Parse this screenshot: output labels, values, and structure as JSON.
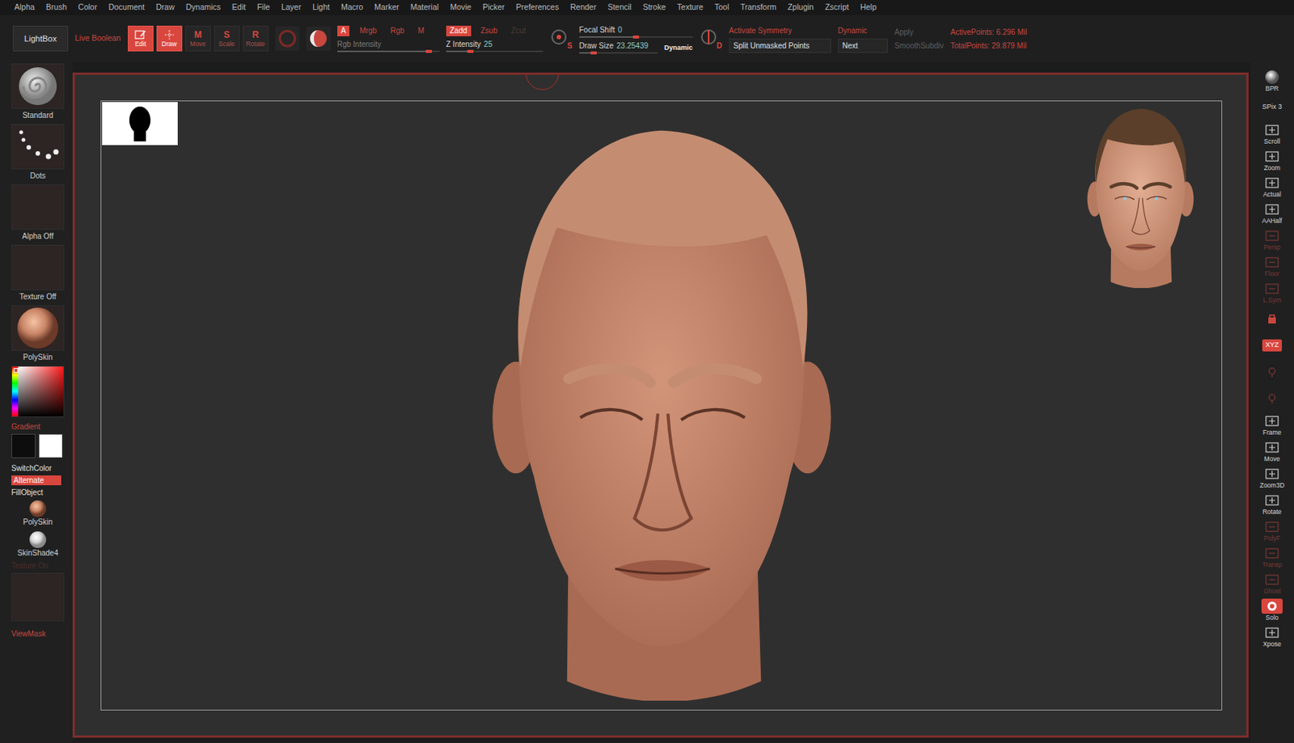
{
  "menu": [
    "Alpha",
    "Brush",
    "Color",
    "Document",
    "Draw",
    "Dynamics",
    "Edit",
    "File",
    "Layer",
    "Light",
    "Macro",
    "Marker",
    "Material",
    "Movie",
    "Picker",
    "Preferences",
    "Render",
    "Stencil",
    "Stroke",
    "Texture",
    "Tool",
    "Transform",
    "Zplugin",
    "Zscript",
    "Help"
  ],
  "toolbar": {
    "lightbox": "LightBox",
    "live_boolean": "Live Boolean",
    "modes": [
      {
        "label": "Edit",
        "kind": "icon",
        "selected": true
      },
      {
        "label": "Draw",
        "kind": "icon",
        "selected": true
      },
      {
        "label": "Move",
        "key": "M",
        "kind": "letter",
        "selected": false
      },
      {
        "label": "Scale",
        "key": "S",
        "kind": "letter",
        "selected": false
      },
      {
        "label": "Rotate",
        "key": "R",
        "kind": "letter",
        "selected": false
      }
    ],
    "color_channels": [
      {
        "label": "A",
        "selected": true
      },
      {
        "label": "Mrgb",
        "selected": false
      },
      {
        "label": "Rgb",
        "selected": false
      },
      {
        "label": "M",
        "selected": false
      }
    ],
    "rgb_intensity": {
      "label": "Rgb Intensity",
      "level": 0.9,
      "disabled": true
    },
    "depth_channels": [
      {
        "label": "Zadd",
        "selected": true,
        "disabled": false
      },
      {
        "label": "Zsub",
        "selected": false,
        "disabled": false
      },
      {
        "label": "Zcut",
        "selected": false,
        "disabled": true
      }
    ],
    "z_intensity": {
      "label": "Z Intensity",
      "value": "25",
      "level": 0.25
    },
    "stroke_key": "S",
    "focal_shift": {
      "label": "Focal Shift",
      "value": "0",
      "level": 0.5
    },
    "draw_size": {
      "label": "Draw Size",
      "value": "23.25439",
      "level": 0.18
    },
    "dynamic_size": {
      "label": "Dynamic",
      "on": true
    },
    "symmetry_key": "D",
    "symmetry": {
      "label": "Activate Symmetry",
      "on": false
    },
    "split": "Split Unmasked Points",
    "dynamic": {
      "label": "Dynamic",
      "on": false
    },
    "next": "Next",
    "apply": {
      "label": "Apply",
      "disabled": true
    },
    "smooth_subdiv": {
      "label": "SmoothSubdiv",
      "disabled": true
    },
    "active_points": "ActivePoints: 6.296 Mil",
    "total_points": "TotalPoints: 29.879 Mil"
  },
  "left": {
    "brush": "Standard",
    "stroke": "Dots",
    "alpha": "Alpha Off",
    "texture": "Texture Off",
    "material": "PolySkin",
    "gradient": "Gradient",
    "swatches": [
      {
        "color": "#0d0d0d"
      },
      {
        "color": "#ffffff"
      }
    ],
    "switch_color": "SwitchColor",
    "alternate": {
      "label": "Alternate",
      "on": true
    },
    "fill_object": "FillObject",
    "materials": [
      {
        "label": "PolySkin",
        "kind": "skin"
      },
      {
        "label": "SkinShade4",
        "kind": "white"
      }
    ],
    "texture_on": {
      "label": "Texture On",
      "disabled": true
    },
    "view_mask": "ViewMask"
  },
  "shelf": [
    {
      "label": "BPR",
      "kind": "sphere",
      "active": false,
      "dimmed": false
    },
    {
      "label": "SPix 3",
      "kind": "text",
      "active": false,
      "dimmed": false
    },
    {
      "label": "Scroll",
      "kind": "tool",
      "active": false,
      "dimmed": false
    },
    {
      "label": "Zoom",
      "kind": "tool",
      "active": false,
      "dimmed": false
    },
    {
      "label": "Actual",
      "kind": "tool",
      "active": false,
      "dimmed": false
    },
    {
      "label": "AAHalf",
      "kind": "tool",
      "active": false,
      "dimmed": false
    },
    {
      "label": "Persp",
      "kind": "tool",
      "active": false,
      "dimmed": true
    },
    {
      "label": "Floor",
      "kind": "tool",
      "active": false,
      "dimmed": true
    },
    {
      "label": "L.Sym",
      "kind": "tool",
      "active": false,
      "dimmed": true
    },
    {
      "kind": "glyph",
      "active": false,
      "dimmed": false
    },
    {
      "label": "XYZ",
      "kind": "text",
      "active": true,
      "dimmed": false
    },
    {
      "kind": "glyph",
      "active": false,
      "dimmed": true
    },
    {
      "kind": "glyph",
      "active": false,
      "dimmed": true
    },
    {
      "label": "Frame",
      "kind": "tool",
      "active": false,
      "dimmed": false
    },
    {
      "label": "Move",
      "kind": "tool",
      "active": false,
      "dimmed": false
    },
    {
      "label": "Zoom3D",
      "kind": "tool",
      "active": false,
      "dimmed": false
    },
    {
      "label": "Rotate",
      "kind": "tool",
      "active": false,
      "dimmed": false
    },
    {
      "label": "PolyF",
      "kind": "tool",
      "active": false,
      "dimmed": true
    },
    {
      "label": "Transp",
      "kind": "tool",
      "active": false,
      "dimmed": true
    },
    {
      "label": "Ghost",
      "kind": "tool",
      "active": false,
      "dimmed": true
    },
    {
      "label": "Solo",
      "kind": "tool",
      "active": true,
      "dimmed": false
    },
    {
      "label": "Xpose",
      "kind": "tool",
      "active": false,
      "dimmed": false
    }
  ]
}
